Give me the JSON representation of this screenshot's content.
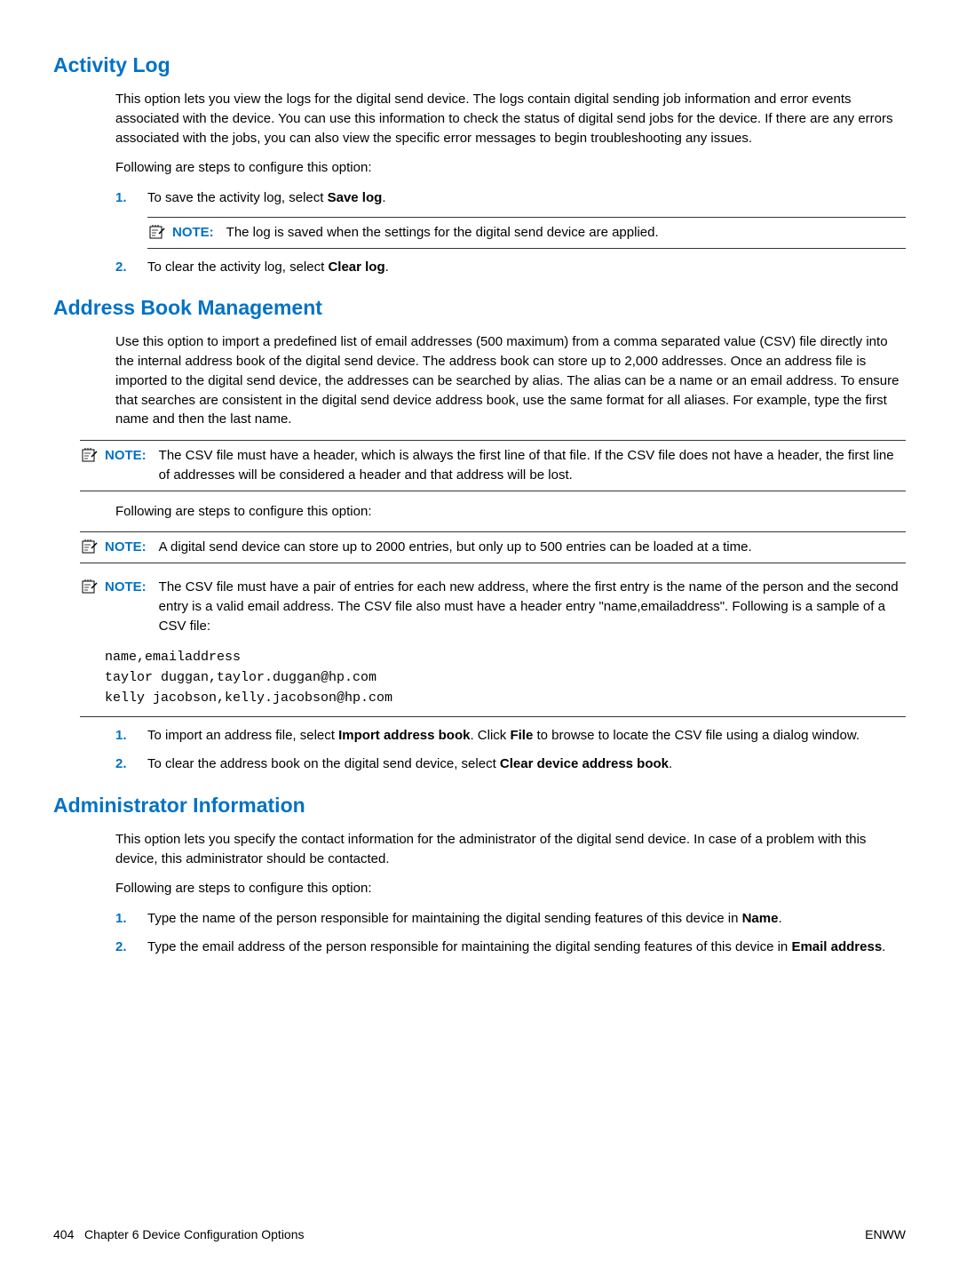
{
  "sections": {
    "activity_log": {
      "heading": "Activity Log",
      "p1": "This option lets you view the logs for the digital send device. The logs contain digital sending job information and error events associated with the device. You can use this information to check the status of digital send jobs for the device. If there are any errors associated with the jobs, you can also view the specific error messages to begin troubleshooting any issues.",
      "p2": "Following are steps to configure this option:",
      "step1_prefix": "To save the activity log, select ",
      "step1_bold": "Save log",
      "step1_suffix": ".",
      "note1_label": "NOTE:",
      "note1_text": "The log is saved when the settings for the digital send device are applied.",
      "step2_prefix": "To clear the activity log, select ",
      "step2_bold": "Clear log",
      "step2_suffix": "."
    },
    "address_book": {
      "heading": "Address Book Management",
      "p1": "Use this option to import a predefined list of email addresses (500 maximum) from a comma separated value (CSV) file directly into the internal address book of the digital send device. The address book can store up to 2,000 addresses. Once an address file is imported to the digital send device, the addresses can be searched by alias. The alias can be a name or an email address. To ensure that searches are consistent in the digital send device address book, use the same format for all aliases. For example, type the first name and then the last name.",
      "note1_label": "NOTE:",
      "note1_text": "The CSV file must have a header, which is always the first line of that file. If the CSV file does not have a header, the first line of addresses will be considered a header and that address will be lost.",
      "p2": "Following are steps to configure this option:",
      "note2_label": "NOTE:",
      "note2_text": "A digital send device can store up to 2000 entries, but only up to 500 entries can be loaded at a time.",
      "note3_label": "NOTE:",
      "note3_text": "The CSV file must have a pair of entries for each new address, where the first entry is the name of the person and the second entry is a valid email address. The CSV file also must have a header entry \"name,emailaddress\". Following is a sample of a CSV file:",
      "code1": "name,emailaddress",
      "code2": "taylor duggan,taylor.duggan@hp.com",
      "code3": "kelly jacobson,kelly.jacobson@hp.com",
      "step1_prefix": "To import an address file, select ",
      "step1_bold1": "Import address book",
      "step1_mid": ". Click ",
      "step1_bold2": "File",
      "step1_suffix": " to browse to locate the CSV file using a dialog window.",
      "step2_prefix": "To clear the address book on the digital send device, select ",
      "step2_bold": "Clear device address book",
      "step2_suffix": "."
    },
    "admin_info": {
      "heading": "Administrator Information",
      "p1": "This option lets you specify the contact information for the administrator of the digital send device. In case of a problem with this device, this administrator should be contacted.",
      "p2": "Following are steps to configure this option:",
      "step1_prefix": "Type the name of the person responsible for maintaining the digital sending features of this device in ",
      "step1_bold": "Name",
      "step1_suffix": ".",
      "step2_prefix": "Type the email address of the person responsible for maintaining the digital sending features of this device in ",
      "step2_bold": "Email address",
      "step2_suffix": "."
    }
  },
  "numbers": {
    "one": "1.",
    "two": "2."
  },
  "footer": {
    "left_page": "404",
    "left_chapter": "Chapter 6   Device Configuration Options",
    "right": "ENWW"
  },
  "icons": {
    "note_alt": "note"
  }
}
